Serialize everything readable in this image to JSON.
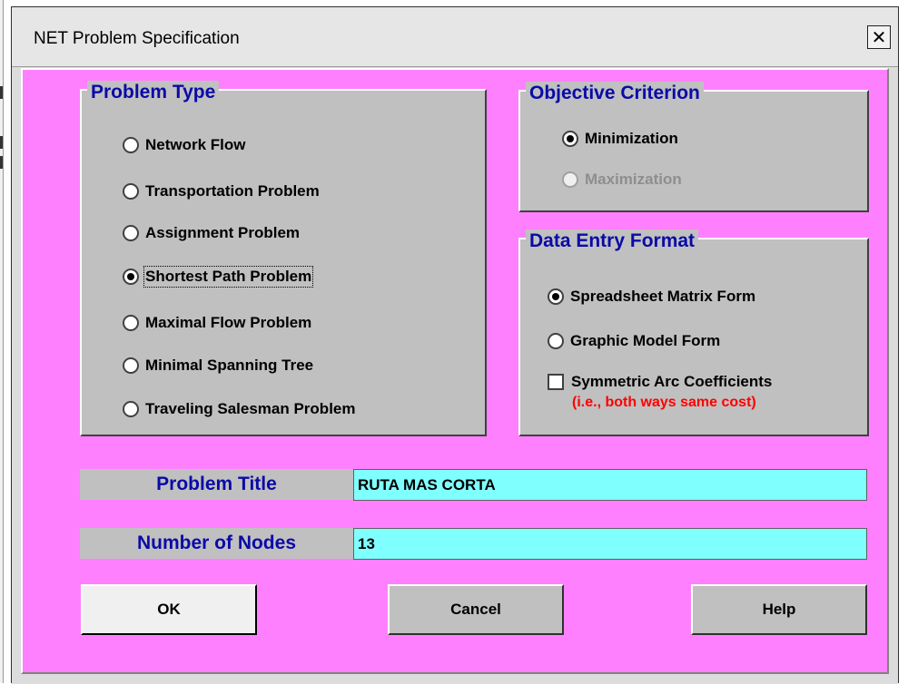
{
  "window": {
    "title": "NET Problem Specification",
    "close_glyph": "✕"
  },
  "problem_type": {
    "label": "Problem Type",
    "selected": "Shortest Path Problem",
    "options": [
      "Network Flow",
      "Transportation Problem",
      "Assignment Problem",
      "Shortest Path Problem",
      "Maximal Flow Problem",
      "Minimal Spanning Tree",
      "Traveling Salesman Problem"
    ]
  },
  "objective": {
    "label": "Objective Criterion",
    "selected": "Minimization",
    "options": [
      "Minimization",
      "Maximization"
    ],
    "disabled": [
      "Maximization"
    ]
  },
  "data_entry": {
    "label": "Data Entry Format",
    "selected": "Spreadsheet Matrix Form",
    "options": [
      "Spreadsheet Matrix Form",
      "Graphic Model Form"
    ],
    "checkbox_label": "Symmetric Arc Coefficients",
    "checkbox_checked": false,
    "note": "(i.e., both ways same cost)"
  },
  "fields": {
    "title_label": "Problem Title",
    "title_value": "RUTA MAS CORTA",
    "nodes_label": "Number of Nodes",
    "nodes_value": "13"
  },
  "buttons": {
    "ok": "OK",
    "cancel": "Cancel",
    "help": "Help"
  },
  "colors": {
    "client_background": "#ff80ff",
    "group_background": "#c0c0c0",
    "heading_text": "#0a0aa8",
    "input_background": "#80ffff",
    "note_text": "#ff0000"
  },
  "icons": {
    "close": "close-icon",
    "radio": "radio-button-icon",
    "checkbox": "checkbox-icon"
  }
}
